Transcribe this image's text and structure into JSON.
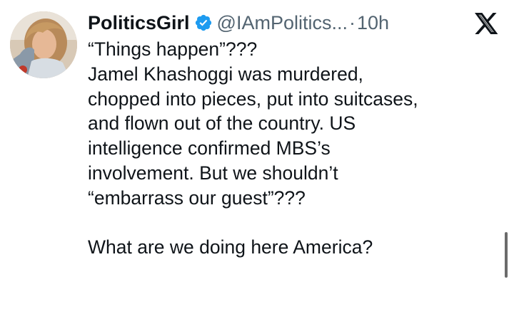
{
  "author": {
    "display_name": "PoliticsGirl",
    "handle": "@IAmPolitics...",
    "separator": "·",
    "time": "10h",
    "avatar": "avatar-photo",
    "verified_icon": "verified-badge-icon",
    "verified_color": "#1d9bf0"
  },
  "platform_icon": "x-logo-icon",
  "tweet": {
    "lines": [
      "“Things happen”???",
      "Jamel Khashoggi was murdered,",
      "chopped into pieces, put into suitcases,",
      "and flown out of the country. US",
      "intelligence confirmed MBS’s",
      "involvement. But we shouldn’t",
      "“embarrass our guest”???"
    ],
    "closing_line": "What are we doing here America?"
  },
  "colors": {
    "text": "#0f1419",
    "muted": "#536471",
    "background": "#ffffff"
  }
}
